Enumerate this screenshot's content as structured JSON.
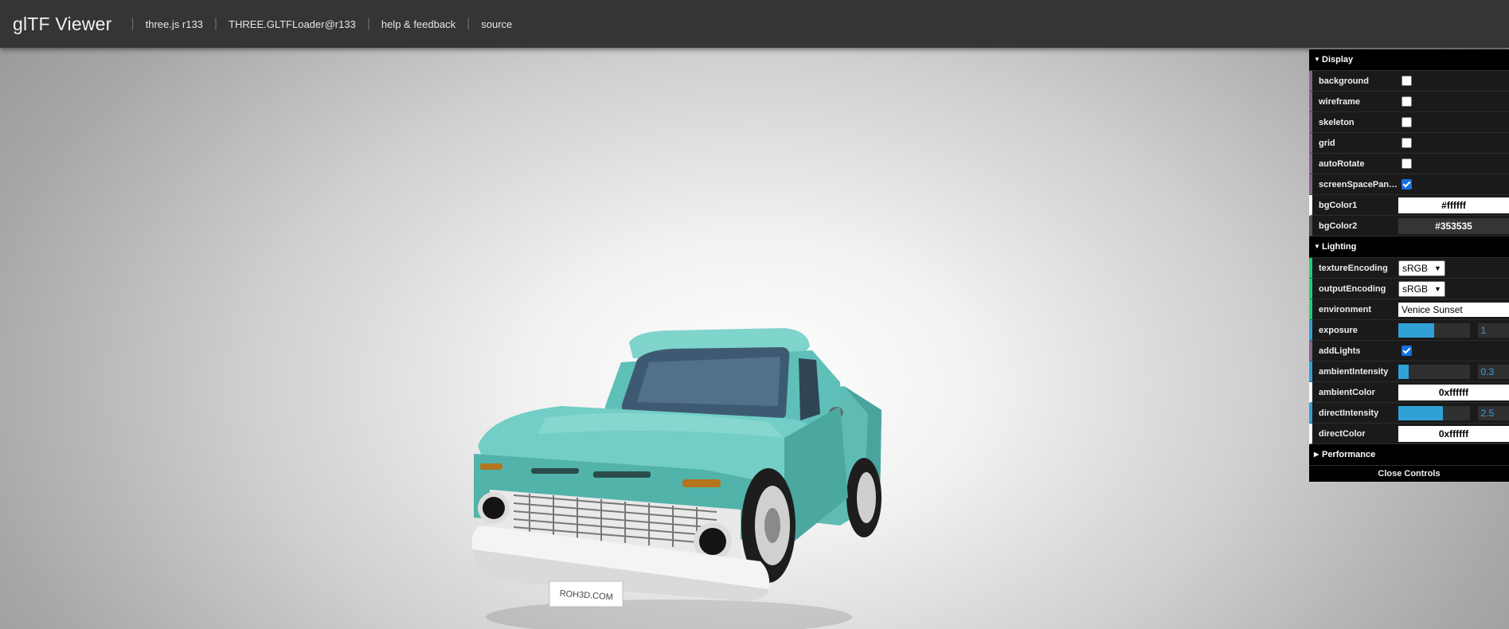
{
  "header": {
    "title": "glTF Viewer",
    "links": [
      "three.js r133",
      "THREE.GLTFLoader@r133",
      "help & feedback",
      "source"
    ]
  },
  "scene": {
    "model": "pickup-truck",
    "plate_text": "ROH3D.COM",
    "truck_color": "#6cc9c2"
  },
  "gui": {
    "display": {
      "title": "Display",
      "background": {
        "label": "background",
        "checked": false
      },
      "wireframe": {
        "label": "wireframe",
        "checked": false
      },
      "skeleton": {
        "label": "skeleton",
        "checked": false
      },
      "grid": {
        "label": "grid",
        "checked": false
      },
      "autoRotate": {
        "label": "autoRotate",
        "checked": false
      },
      "screenSpacePanning": {
        "label": "screenSpacePan…",
        "checked": true
      },
      "bgColor1": {
        "label": "bgColor1",
        "value": "#ffffff"
      },
      "bgColor2": {
        "label": "bgColor2",
        "value": "#353535"
      }
    },
    "lighting": {
      "title": "Lighting",
      "textureEncoding": {
        "label": "textureEncoding",
        "value": "sRGB"
      },
      "outputEncoding": {
        "label": "outputEncoding",
        "value": "sRGB"
      },
      "environment": {
        "label": "environment",
        "value": "Venice Sunset"
      },
      "exposure": {
        "label": "exposure",
        "value": "1",
        "fill_fraction": 0.5
      },
      "addLights": {
        "label": "addLights",
        "checked": true
      },
      "ambientIntensity": {
        "label": "ambientIntensity",
        "value": "0.3",
        "fill_fraction": 0.15
      },
      "ambientColor": {
        "label": "ambientColor",
        "value": "0xffffff"
      },
      "directIntensity": {
        "label": "directIntensity",
        "value": "2.5",
        "fill_fraction": 0.62
      },
      "directColor": {
        "label": "directColor",
        "value": "0xffffff"
      }
    },
    "performance": {
      "title": "Performance"
    },
    "close_label": "Close Controls"
  }
}
